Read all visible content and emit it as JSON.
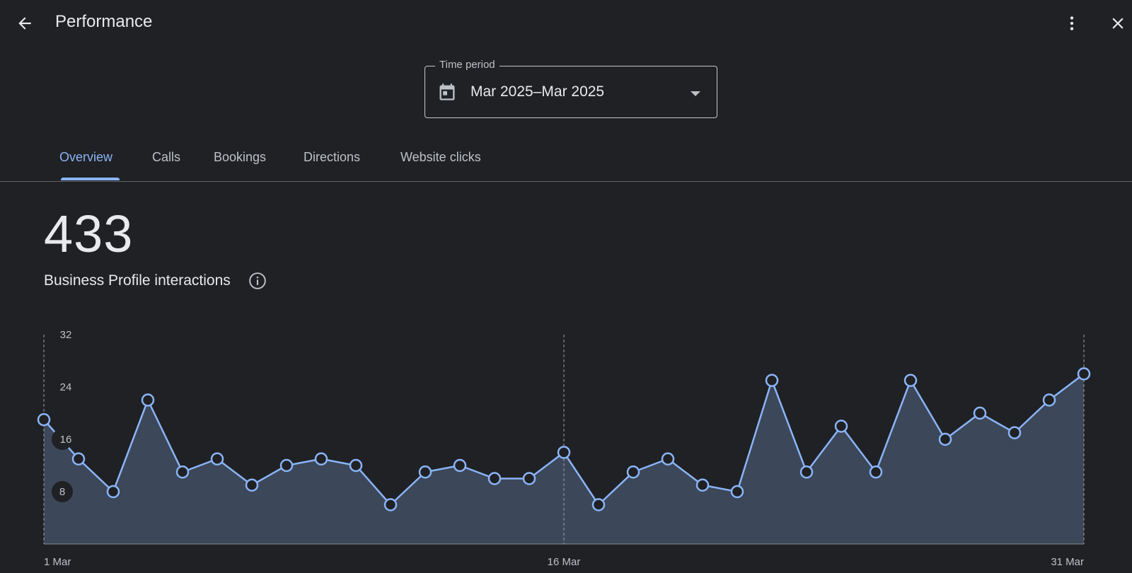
{
  "header": {
    "title": "Performance"
  },
  "period": {
    "legend": "Time period",
    "value": "Mar 2025–Mar 2025"
  },
  "tabs": [
    {
      "label": "Overview",
      "active": true
    },
    {
      "label": "Calls"
    },
    {
      "label": "Bookings"
    },
    {
      "label": "Directions"
    },
    {
      "label": "Website clicks"
    }
  ],
  "metric": {
    "value": "433",
    "label": "Business Profile interactions"
  },
  "icons": {
    "back": "arrow-back-icon",
    "more": "more-vert-icon",
    "close": "close-icon",
    "calendar": "calendar-icon",
    "caret": "caret-down-icon",
    "info": "info-icon"
  },
  "colors": {
    "accent": "#8ab4f8",
    "fill": "#3c4759",
    "background": "#202124"
  },
  "chart_data": {
    "type": "area",
    "x": [
      "1 Mar",
      "2 Mar",
      "3 Mar",
      "4 Mar",
      "5 Mar",
      "6 Mar",
      "7 Mar",
      "8 Mar",
      "9 Mar",
      "10 Mar",
      "11 Mar",
      "12 Mar",
      "13 Mar",
      "14 Mar",
      "15 Mar",
      "16 Mar",
      "17 Mar",
      "18 Mar",
      "19 Mar",
      "20 Mar",
      "21 Mar",
      "22 Mar",
      "23 Mar",
      "24 Mar",
      "25 Mar",
      "26 Mar",
      "27 Mar",
      "28 Mar",
      "29 Mar",
      "30 Mar",
      "31 Mar"
    ],
    "values": [
      19,
      13,
      8,
      22,
      11,
      13,
      9,
      12,
      13,
      12,
      6,
      11,
      12,
      10,
      10,
      14,
      6,
      11,
      13,
      9,
      8,
      25,
      11,
      18,
      11,
      25,
      16,
      20,
      17,
      22,
      26
    ],
    "yticks": [
      8,
      16,
      24,
      32
    ],
    "ylim": [
      0,
      32
    ],
    "xtick_labels": [
      "1 Mar",
      "16 Mar",
      "31 Mar"
    ],
    "grid": "vertical dashed at 1 Mar, 16 Mar, 31 Mar"
  }
}
